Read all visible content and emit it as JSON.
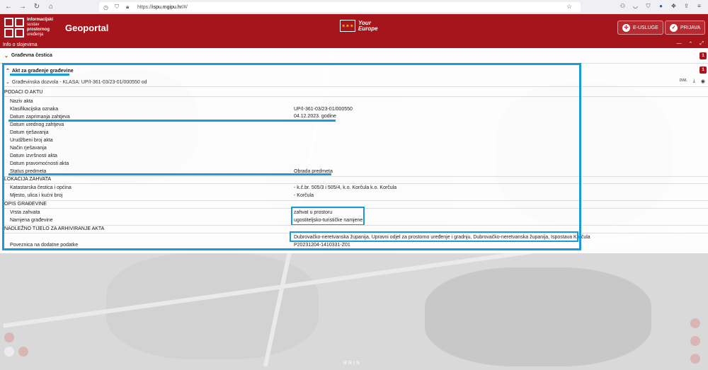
{
  "browser": {
    "url_prefix": "https://",
    "url_host": "ispu.mgipu.hr",
    "url_path": "/#/"
  },
  "header": {
    "logo_lines": [
      "Informacijski",
      "sustav",
      "prostornog",
      "uređenja"
    ],
    "app_title": "Geoportal",
    "eu_text_1": "Your",
    "eu_text_2": "Europe",
    "eusluge_label": "E-USLUGE",
    "prijava_label": "PRIJAVA"
  },
  "panel": {
    "bar_title": "Info o slojevima",
    "section_1": "Građevna čestica",
    "section_1_badge": "1",
    "akt_title": "Akt za građenje građevine",
    "akt_badge": "1",
    "dozvola": "Građevinska dozvola - KLASA: UP/I-361-03/23-01/000550 od",
    "dozvola_icon_label": "DWL"
  },
  "podaci": {
    "header": "PODACI O AKTU",
    "rows": [
      {
        "label": "Naziv akta",
        "value": ""
      },
      {
        "label": "Klasifikacijska oznaka",
        "value": "UP/I-361-03/23-01/000550"
      },
      {
        "label": "Datum zaprimanja zahtjeva",
        "value": "04.12.2023. godine"
      },
      {
        "label": "Datum urednog zahtjeva",
        "value": ""
      },
      {
        "label": "Datum rješavanja",
        "value": ""
      },
      {
        "label": "Urudžbeni broj akta",
        "value": ""
      },
      {
        "label": "Način rješavanja",
        "value": ""
      },
      {
        "label": "Datum izvršnosti akta",
        "value": ""
      },
      {
        "label": "Datum pravomoćnosti akta",
        "value": ""
      },
      {
        "label": "Status predmeta",
        "value": "Obrada predmeta"
      }
    ]
  },
  "lokacija": {
    "header": "LOKACIJA ZAHVATA",
    "rows": [
      {
        "label": "Katastarska čestica i općina",
        "value": "- k.č.br. 505/3 i 505/4, k.o. Korčula k.o. Korčula"
      },
      {
        "label": "Mjesto, ulica i kućni broj",
        "value": "- Korčula"
      }
    ]
  },
  "opis": {
    "header": "OPIS GRAĐEVINE",
    "rows": [
      {
        "label": "Vrsta zahvata",
        "value": "zahvat u prostoru"
      },
      {
        "label": "Namjena građevine",
        "value": "ugostiteljsko-turističke namjene"
      }
    ]
  },
  "nadlezno": {
    "header": "NADLEŽNO TIJELO ZA ARHIVIRANJE AKTA",
    "value": "Dubrovačko-neretvanska županija, Upravni odjel za prostorno uređenje i gradnju, Dubrovačko-neretvanska županija, Ispostava Korčula",
    "poveznica_label": "Poveznica na dodatne podatke",
    "poveznica_value": "P20231204-1410331-Z01"
  },
  "map_footer": "RRIS"
}
